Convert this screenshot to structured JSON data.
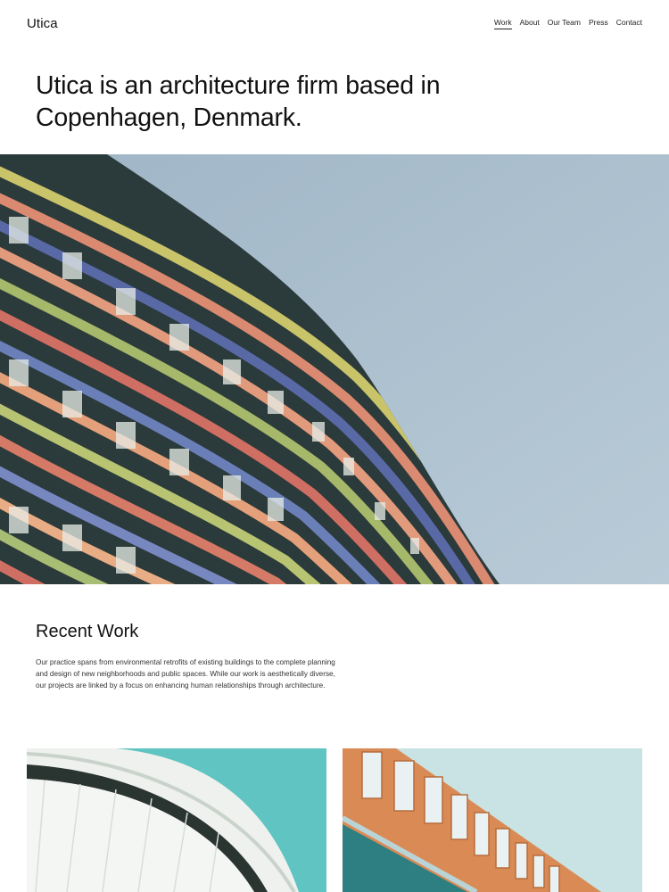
{
  "site": {
    "logo": "Utica"
  },
  "nav": {
    "items": [
      {
        "label": "Work",
        "active": true
      },
      {
        "label": "About",
        "active": false
      },
      {
        "label": "Our Team",
        "active": false
      },
      {
        "label": "Press",
        "active": false
      },
      {
        "label": "Contact",
        "active": false
      }
    ]
  },
  "hero": {
    "title": "Utica is an architecture firm based in Copenhagen, Denmark."
  },
  "recent": {
    "title": "Recent Work",
    "description": "Our practice spans from environmental retrofits of existing buildings to the complete planning and design of new neighborhoods and public spaces. While our work is aesthetically diverse, our projects are linked by a focus on enhancing human relationships through architecture."
  },
  "colors": {
    "sky": "#a9bdcc",
    "text": "#111111",
    "thumb_left_sky": "#5fc4c2",
    "thumb_right_sky": "#c9e2e3",
    "facade_orange": "#d98a55"
  }
}
